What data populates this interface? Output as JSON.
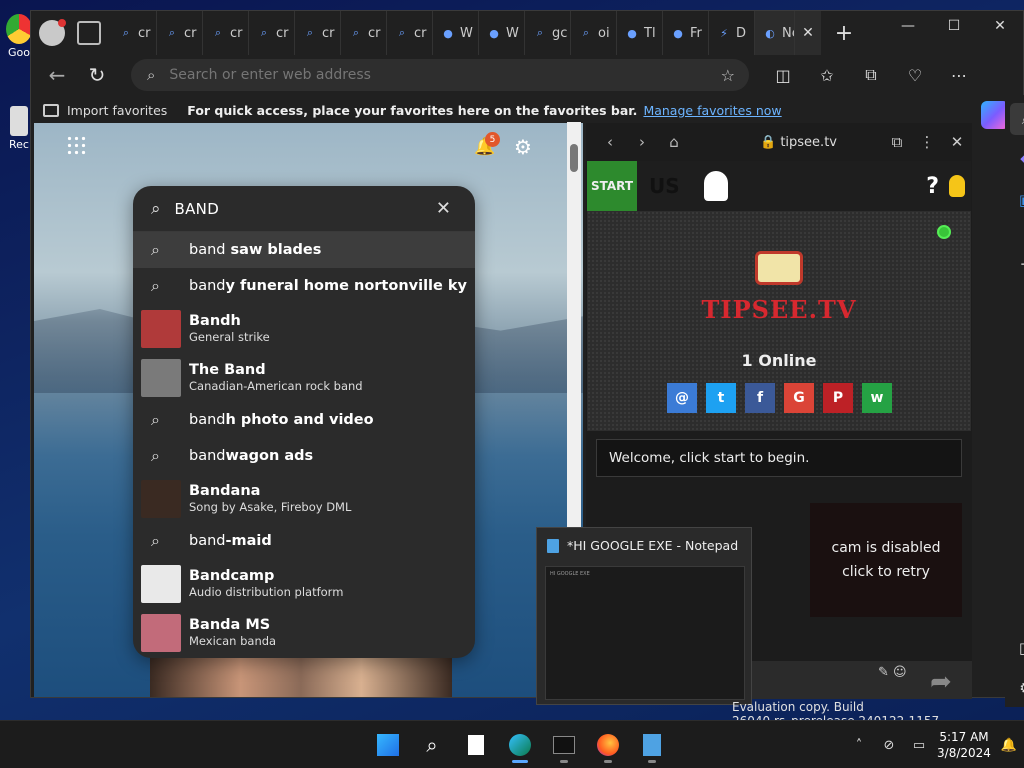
{
  "desktop": {
    "icon1_label": "Goo",
    "icon2_label": "Rec"
  },
  "browser": {
    "tabs": [
      {
        "label": "cr",
        "icon": "search-icon"
      },
      {
        "label": "cr",
        "icon": "search-icon"
      },
      {
        "label": "cr",
        "icon": "search-icon"
      },
      {
        "label": "cr",
        "icon": "search-icon"
      },
      {
        "label": "cr",
        "icon": "search-icon"
      },
      {
        "label": "cr",
        "icon": "search-icon"
      },
      {
        "label": "cr",
        "icon": "search-icon"
      },
      {
        "label": "W",
        "icon": "globe-icon"
      },
      {
        "label": "W",
        "icon": "edge-icon"
      },
      {
        "label": "gc",
        "icon": "search-icon"
      },
      {
        "label": "oi",
        "icon": "search-icon"
      },
      {
        "label": "Tl",
        "icon": "reddit-icon"
      },
      {
        "label": "Fr",
        "icon": "emoji-icon"
      },
      {
        "label": "D",
        "icon": "bolt-icon"
      }
    ],
    "active_tab_label": "Ne",
    "address_placeholder": "Search or enter web address",
    "favbar": {
      "import_label": "Import favorites",
      "hint": "For quick access, place your favorites here on the favorites bar.",
      "manage_link": "Manage favorites now"
    }
  },
  "newtab": {
    "notification_count": "5"
  },
  "suggest": {
    "query": "BAND",
    "items": [
      {
        "type": "search",
        "prefix": "band",
        "bold": " saw blades"
      },
      {
        "type": "search",
        "prefix": "band",
        "bold": "y funeral home nortonville ky"
      },
      {
        "type": "entity",
        "title": "Bandh",
        "subtitle": "General strike",
        "thumb": "#b03a3a"
      },
      {
        "type": "entity",
        "title": "The Band",
        "subtitle": "Canadian-American rock band",
        "thumb": "#7a7a7a"
      },
      {
        "type": "search",
        "prefix": "band",
        "bold": "h photo and video"
      },
      {
        "type": "search",
        "prefix": "band",
        "bold": "wagon ads"
      },
      {
        "type": "entity",
        "title": "Bandana",
        "subtitle": "Song by Asake, Fireboy DML",
        "thumb": "#3a2a22"
      },
      {
        "type": "search",
        "prefix": "band",
        "bold": "-maid"
      },
      {
        "type": "entity",
        "title": "Bandcamp",
        "subtitle": "Audio distribution platform",
        "thumb": "#e9e9e9"
      },
      {
        "type": "entity",
        "title": "Banda MS",
        "subtitle": "Mexican banda",
        "thumb": "#c26b7a"
      }
    ]
  },
  "side": {
    "url": "tipsee.tv",
    "start_label": "START",
    "country": "US",
    "help": "?",
    "logo_text": "TIPSEE.TV",
    "online": "1 Online",
    "share_colors": [
      "#3b7bd6",
      "#1da1f2",
      "#3b5998",
      "#db4437",
      "#bd2126",
      "#25a244"
    ],
    "share_glyphs": [
      "@",
      "t",
      "f",
      "G",
      "P",
      "w"
    ],
    "welcome": "Welcome, click start to begin.",
    "cam_line1": "cam is disabled",
    "cam_line2": "click to retry"
  },
  "notepad": {
    "title": "*HI GOOGLE EXE - Notepad",
    "preview_text": "HI GOOGLE EXE"
  },
  "eval_text": "Evaluation copy. Build 26040.rs_prerelease.240122-1157",
  "clock": {
    "time": "5:17 AM",
    "date": "3/8/2024"
  }
}
